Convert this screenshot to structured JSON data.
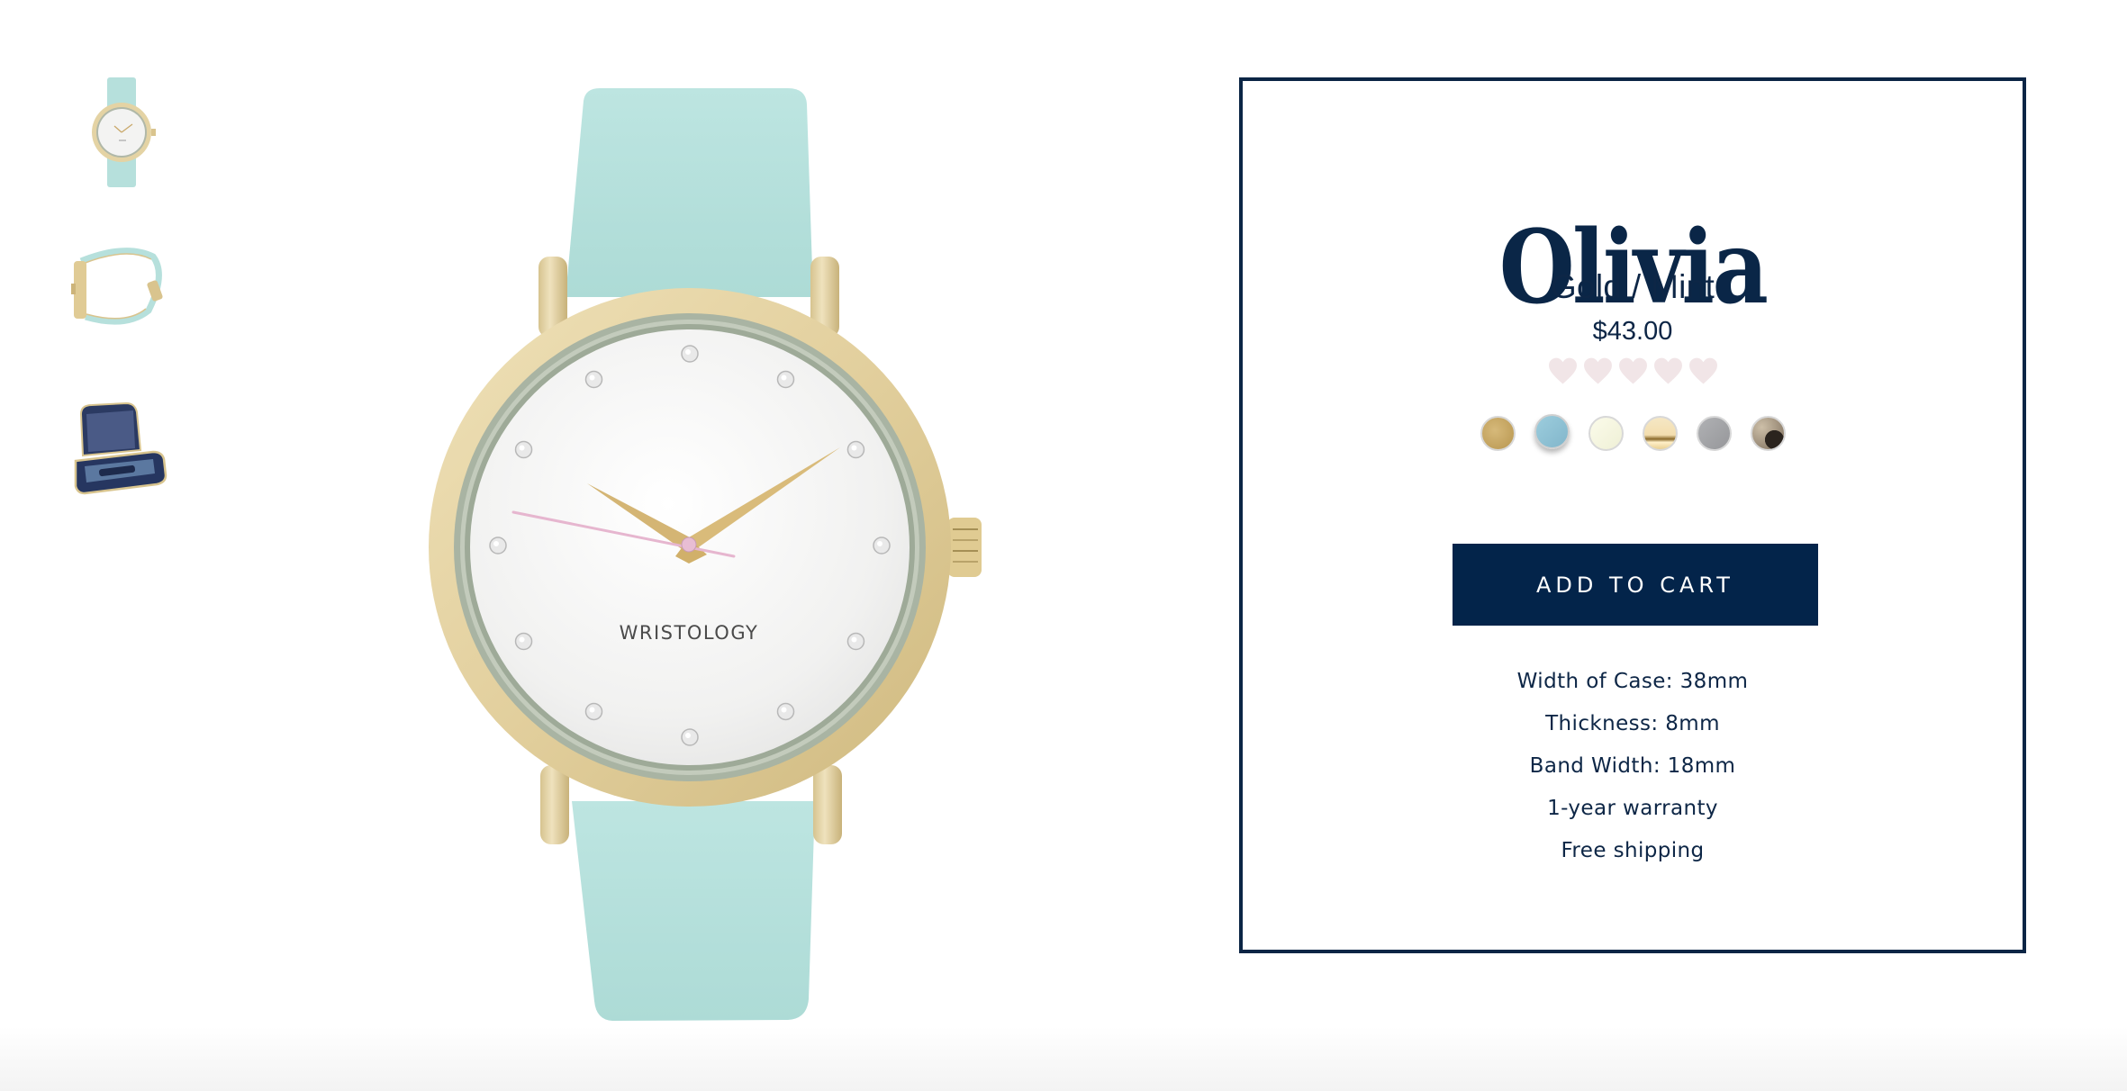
{
  "gallery": {
    "thumbnails": [
      {
        "label": "Front view",
        "kind": "watch-front"
      },
      {
        "label": "Side view",
        "kind": "watch-side"
      },
      {
        "label": "Travel case",
        "kind": "case"
      }
    ],
    "main_image": {
      "kind": "watch-front",
      "dial_brand": "WRISTOLOGY",
      "colors": {
        "strap": "#b6e0dc",
        "case_gold": "#e4d3a4",
        "inner_ring": "#a9b4a3",
        "dial": "#f2f2f1",
        "hands": "#d4b574",
        "seconds_hand": "#e6b6cf"
      }
    }
  },
  "product": {
    "name": "Olivia",
    "variant": "Gold / Mint",
    "price": "$43.00",
    "rating": {
      "value": 0,
      "max": 5,
      "icon": "heart-icon",
      "empty_color": "#f1e5e7"
    },
    "swatches": [
      {
        "name": "Gold",
        "color": "#c7a564",
        "selected": false
      },
      {
        "name": "Mint",
        "color": "#8fc1d4",
        "selected": true
      },
      {
        "name": "Cream",
        "color": "#f6f7e1",
        "selected": false
      },
      {
        "name": "Polished Gold",
        "color": "#f0dba8",
        "selected": false
      },
      {
        "name": "Gray",
        "color": "#a5a6a9",
        "selected": false
      },
      {
        "name": "Tortoise",
        "color": "#8a7a66",
        "selected": false
      }
    ],
    "add_to_cart_label": "ADD TO CART",
    "specs": [
      "Width of Case: 38mm",
      "Thickness: 8mm",
      "Band Width: 18mm",
      "1-year warranty",
      "Free shipping"
    ],
    "accent_color": "#03244a"
  }
}
